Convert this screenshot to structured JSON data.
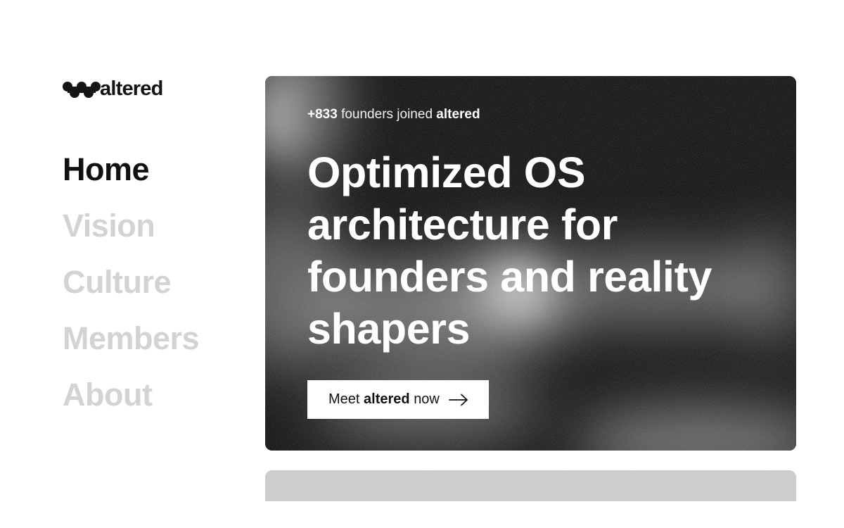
{
  "brand": {
    "name": "altered",
    "logo_icon": "linked-blobs-logo-icon"
  },
  "nav": {
    "items": [
      {
        "label": "Home",
        "active": true
      },
      {
        "label": "Vision",
        "active": false
      },
      {
        "label": "Culture",
        "active": false
      },
      {
        "label": "Members",
        "active": false
      },
      {
        "label": "About",
        "active": false
      }
    ]
  },
  "hero": {
    "stat": {
      "count": "+833",
      "text": "founders joined",
      "brand": "altered"
    },
    "title": "Optimized OS architecture for founders and reality shapers",
    "cta": {
      "prefix": "Meet",
      "brand": "altered",
      "suffix": "now",
      "icon": "arrow-right-icon"
    }
  },
  "colors": {
    "background": "#ffffff",
    "text_primary": "#111111",
    "nav_inactive": "#d3d3d3",
    "hero_background": "#0b0b0b",
    "hero_text": "#ffffff",
    "button_background": "#ffffff",
    "next_card": "#cfcfcf"
  }
}
